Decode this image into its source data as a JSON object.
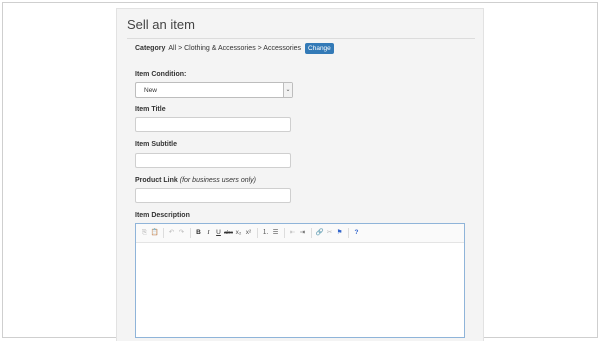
{
  "page": {
    "title": "Sell an item"
  },
  "category": {
    "label": "Category",
    "path": "All > Clothing & Accessories > Accessories",
    "change_label": "Change"
  },
  "condition": {
    "label": "Item Condition:",
    "value": "New"
  },
  "title_field": {
    "label": "Item Title",
    "value": ""
  },
  "subtitle_field": {
    "label": "Item Subtitle",
    "value": ""
  },
  "product_link": {
    "label": "Product Link",
    "hint": "(for business users only)",
    "value": ""
  },
  "description": {
    "label": "Item Description",
    "toolbar": [
      {
        "name": "copy-icon",
        "glyph": "⎘",
        "disabled": true
      },
      {
        "name": "paste-icon",
        "glyph": "📋",
        "disabled": false
      },
      {
        "sep": true
      },
      {
        "name": "undo-icon",
        "glyph": "↶",
        "disabled": true
      },
      {
        "name": "redo-icon",
        "glyph": "↷",
        "disabled": true
      },
      {
        "sep": true
      },
      {
        "name": "bold-icon",
        "glyph": "B",
        "style": "b"
      },
      {
        "name": "italic-icon",
        "glyph": "I",
        "style": "i"
      },
      {
        "name": "underline-icon",
        "glyph": "U",
        "style": "u"
      },
      {
        "name": "strikethrough-icon",
        "glyph": "abc",
        "style": "s"
      },
      {
        "name": "subscript-icon",
        "glyph": "x₂"
      },
      {
        "name": "superscript-icon",
        "glyph": "x²"
      },
      {
        "sep": true
      },
      {
        "name": "numbered-list-icon",
        "glyph": "⒈"
      },
      {
        "name": "bullet-list-icon",
        "glyph": "☰"
      },
      {
        "sep": true
      },
      {
        "name": "outdent-icon",
        "glyph": "⇤",
        "disabled": true
      },
      {
        "name": "indent-icon",
        "glyph": "⇥"
      },
      {
        "sep": true
      },
      {
        "name": "link-icon",
        "glyph": "🔗"
      },
      {
        "name": "unlink-icon",
        "glyph": "✂",
        "disabled": true
      },
      {
        "name": "anchor-flag-icon",
        "glyph": "⚑",
        "style": "flag"
      },
      {
        "sep": true
      },
      {
        "name": "help-icon",
        "glyph": "?",
        "style": "q"
      }
    ]
  }
}
